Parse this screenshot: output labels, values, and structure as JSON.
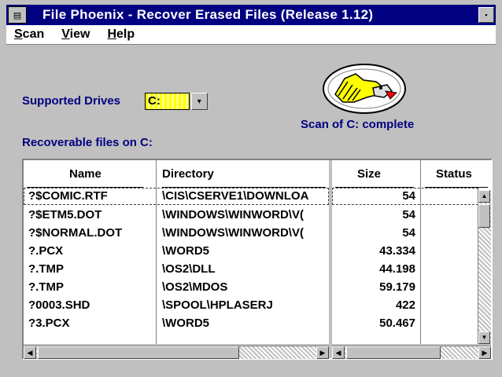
{
  "window": {
    "title": "File Phoenix - Recover Erased Files (Release 1.12)",
    "sysmenu_icon": "system-menu-icon",
    "minimize_icon": "minimize-icon"
  },
  "menu": {
    "items": [
      {
        "underline": "S",
        "rest": "can"
      },
      {
        "underline": "V",
        "rest": "iew"
      },
      {
        "underline": "H",
        "rest": "elp"
      }
    ]
  },
  "drives": {
    "label": "Supported Drives",
    "selected": "C:",
    "dropdown_icon": "dropdown-arrow-icon"
  },
  "scan": {
    "status": "Scan of C: complete",
    "logo_icon": "phoenix-logo-icon"
  },
  "files": {
    "label": "Recoverable files on C:",
    "columns": [
      "Name",
      "Directory",
      "Size",
      "Status"
    ],
    "rows": [
      {
        "name": "?$COMIC.RTF",
        "directory": "\\CIS\\CSERVE1\\DOWNLOA",
        "size": "54",
        "status": ""
      },
      {
        "name": "?$ETM5.DOT",
        "directory": "\\WINDOWS\\WINWORD\\V(",
        "size": "54",
        "status": ""
      },
      {
        "name": "?$NORMAL.DOT",
        "directory": "\\WINDOWS\\WINWORD\\V(",
        "size": "54",
        "status": ""
      },
      {
        "name": "?.PCX",
        "directory": "\\WORD5",
        "size": "43.334",
        "status": ""
      },
      {
        "name": "?.TMP",
        "directory": "\\OS2\\DLL",
        "size": "44.198",
        "status": ""
      },
      {
        "name": "?.TMP",
        "directory": "\\OS2\\MDOS",
        "size": "59.179",
        "status": ""
      },
      {
        "name": "?0003.SHD",
        "directory": "\\SPOOL\\HPLASERJ",
        "size": "422",
        "status": ""
      },
      {
        "name": "?3.PCX",
        "directory": "\\WORD5",
        "size": "50.467",
        "status": ""
      }
    ]
  },
  "colors": {
    "title_bar": "#000080",
    "label_text": "#000080",
    "window_bg": "#c0c0c0",
    "drive_field": "#ffff00"
  }
}
